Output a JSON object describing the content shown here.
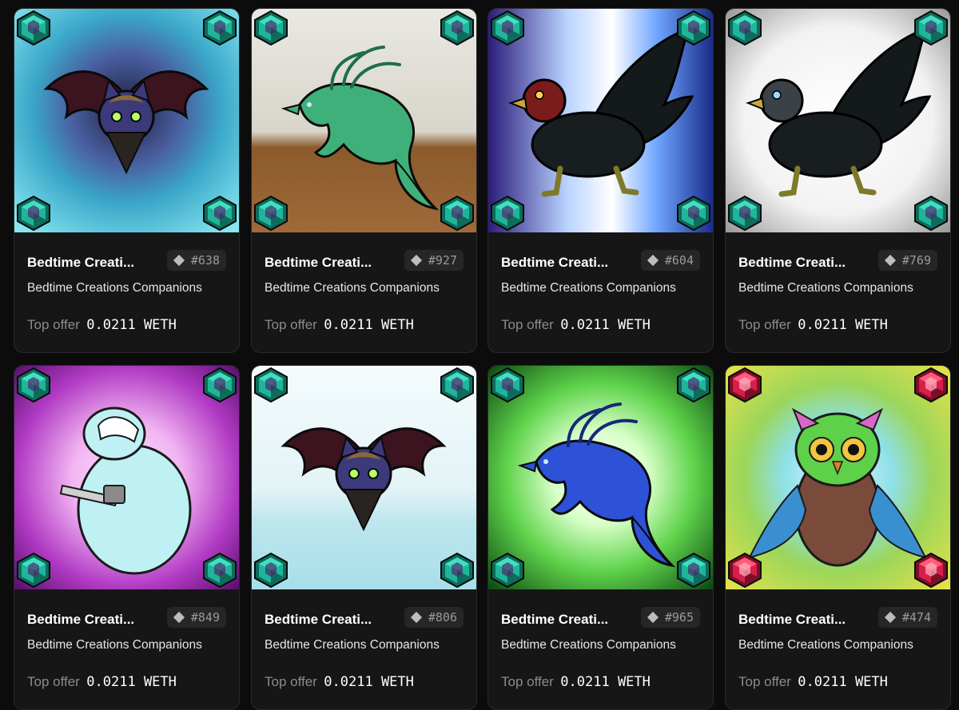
{
  "grid": {
    "cards": [
      {
        "name": "Bedtime Creati...",
        "token_id": "#638",
        "collection": "Bedtime Creations Companions",
        "offer_label": "Top offer",
        "offer_value": "0.0211 WETH",
        "creature": "bat",
        "bg": "ice-cave",
        "gem": "teal"
      },
      {
        "name": "Bedtime Creati...",
        "token_id": "#927",
        "collection": "Bedtime Creations Companions",
        "offer_label": "Top offer",
        "offer_value": "0.0211 WETH",
        "creature": "fox",
        "bg": "desert",
        "gem": "teal"
      },
      {
        "name": "Bedtime Creati...",
        "token_id": "#604",
        "collection": "Bedtime Creations Companions",
        "offer_label": "Top offer",
        "offer_value": "0.0211 WETH",
        "creature": "griffin",
        "bg": "blue-light",
        "gem": "teal"
      },
      {
        "name": "Bedtime Creati...",
        "token_id": "#769",
        "collection": "Bedtime Creations Companions",
        "offer_label": "Top offer",
        "offer_value": "0.0211 WETH",
        "creature": "griffin-dark",
        "bg": "white-burst",
        "gem": "teal"
      },
      {
        "name": "Bedtime Creati...",
        "token_id": "#849",
        "collection": "Bedtime Creations Companions",
        "offer_label": "Top offer",
        "offer_value": "0.0211 WETH",
        "creature": "bear",
        "bg": "pink-swirl",
        "gem": "teal"
      },
      {
        "name": "Bedtime Creati...",
        "token_id": "#806",
        "collection": "Bedtime Creations Companions",
        "offer_label": "Top offer",
        "offer_value": "0.0211 WETH",
        "creature": "bat",
        "bg": "pale-sky",
        "gem": "teal"
      },
      {
        "name": "Bedtime Creati...",
        "token_id": "#965",
        "collection": "Bedtime Creations Companions",
        "offer_label": "Top offer",
        "offer_value": "0.0211 WETH",
        "creature": "fox-blue",
        "bg": "green-swirl",
        "gem": "teal"
      },
      {
        "name": "Bedtime Creati...",
        "token_id": "#474",
        "collection": "Bedtime Creations Companions",
        "offer_label": "Top offer",
        "offer_value": "0.0211 WETH",
        "creature": "owl",
        "bg": "yellow-glow",
        "gem": "ruby"
      }
    ]
  },
  "colors": {
    "page_bg": "#0c0c0c",
    "card_bg": "#161616",
    "card_border": "#2a2a2a",
    "badge_bg": "#262626",
    "gem_teal": "#1fb59a",
    "gem_ruby": "#d61f4a"
  },
  "icons": {
    "token_badge": "eth-diamond-icon",
    "corner_gem": "gem-icon"
  }
}
